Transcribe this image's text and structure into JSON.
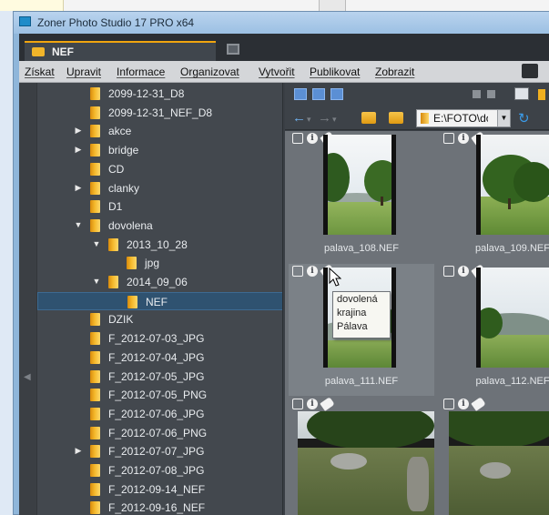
{
  "window": {
    "title": "Zoner Photo Studio 17 PRO x64"
  },
  "tab": {
    "label": "NEF"
  },
  "menu": [
    "Získat",
    "Upravit",
    "Informace",
    "Organizovat",
    "Vytvořit",
    "Publikovat",
    "Zobrazit"
  ],
  "tree": [
    {
      "label": "2099-12-31_D8",
      "level": 1,
      "toggle": ""
    },
    {
      "label": "2099-12-31_NEF_D8",
      "level": 1,
      "toggle": ""
    },
    {
      "label": "akce",
      "level": 1,
      "toggle": "▶"
    },
    {
      "label": "bridge",
      "level": 1,
      "toggle": "▶"
    },
    {
      "label": "CD",
      "level": 1,
      "toggle": ""
    },
    {
      "label": "clanky",
      "level": 1,
      "toggle": "▶"
    },
    {
      "label": "D1",
      "level": 1,
      "toggle": ""
    },
    {
      "label": "dovolena",
      "level": 1,
      "toggle": "▼"
    },
    {
      "label": "2013_10_28",
      "level": 2,
      "toggle": "▼"
    },
    {
      "label": "jpg",
      "level": 3,
      "toggle": ""
    },
    {
      "label": "2014_09_06",
      "level": 2,
      "toggle": "▼"
    },
    {
      "label": "NEF",
      "level": 3,
      "toggle": "",
      "selected": true
    },
    {
      "label": "DZIK",
      "level": 1,
      "toggle": ""
    },
    {
      "label": "F_2012-07-03_JPG",
      "level": 1,
      "toggle": ""
    },
    {
      "label": "F_2012-07-04_JPG",
      "level": 1,
      "toggle": ""
    },
    {
      "label": "F_2012-07-05_JPG",
      "level": 1,
      "toggle": ""
    },
    {
      "label": "F_2012-07-05_PNG",
      "level": 1,
      "toggle": ""
    },
    {
      "label": "F_2012-07-06_JPG",
      "level": 1,
      "toggle": ""
    },
    {
      "label": "F_2012-07-06_PNG",
      "level": 1,
      "toggle": ""
    },
    {
      "label": "F_2012-07-07_JPG",
      "level": 1,
      "toggle": "▶"
    },
    {
      "label": "F_2012-07-08_JPG",
      "level": 1,
      "toggle": ""
    },
    {
      "label": "F_2012-09-14_NEF",
      "level": 1,
      "toggle": ""
    },
    {
      "label": "F_2012-09-16_NEF",
      "level": 1,
      "toggle": ""
    }
  ],
  "path": {
    "value": "E:\\FOTO\\do"
  },
  "thumbnails": [
    {
      "caption": "palava_108.NEF"
    },
    {
      "caption": "palava_109.NEF"
    },
    {
      "caption": "palava_111.NEF"
    },
    {
      "caption": "palava_112.NEF"
    },
    {
      "caption": ""
    },
    {
      "caption": ""
    }
  ],
  "tooltip": {
    "lines": [
      "dovolená",
      "krajina",
      "Pálava"
    ]
  },
  "icons": {
    "tab": "folder-icon",
    "thumbnail_overlay": [
      "camera-icon",
      "info-icon",
      "tag-icon"
    ],
    "nav": [
      "back-arrow-icon",
      "forward-arrow-icon",
      "folder-up-icon",
      "folder-icon",
      "refresh-icon"
    ]
  },
  "colors": {
    "accent": "#f0a50f",
    "selection": "#2f5270",
    "folder": "#f4b82b"
  }
}
